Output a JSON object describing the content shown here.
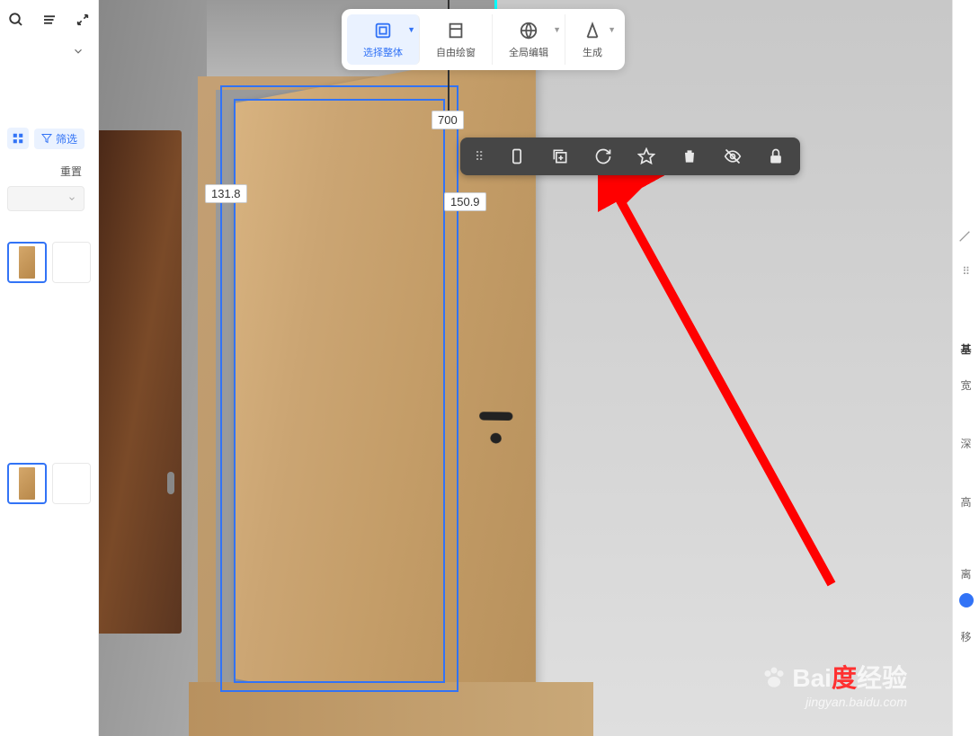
{
  "sidebar": {
    "filter_label": "筛选",
    "reset_label": "重置"
  },
  "toolbar": {
    "items": [
      {
        "label": "选择整体",
        "icon": "select-icon"
      },
      {
        "label": "自由绘窗",
        "icon": "draw-icon"
      },
      {
        "label": "全局编辑",
        "icon": "global-icon"
      },
      {
        "label": "生成",
        "icon": "generate-icon"
      }
    ]
  },
  "dimensions": {
    "top": "700",
    "left": "131.8",
    "right": "150.9"
  },
  "right_panel": {
    "labels": [
      "基",
      "宽",
      "深",
      "高",
      "离",
      "移"
    ]
  },
  "watermark": {
    "brand": "Bai",
    "suffix": "度",
    "text": "经验",
    "url": "jingyan.baidu.com"
  }
}
